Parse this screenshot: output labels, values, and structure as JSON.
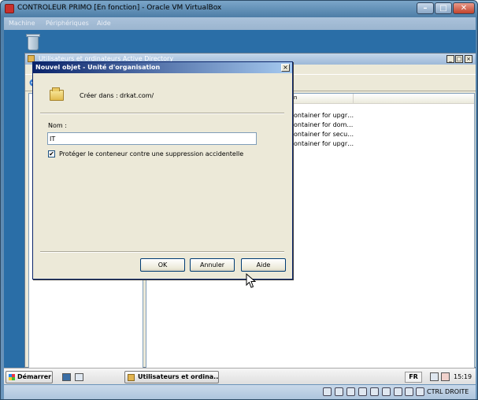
{
  "vbox": {
    "title": "CONTROLEUR PRIMO [En fonction] - Oracle VM VirtualBox",
    "menu": [
      "Machine",
      "Périphériques",
      "Aide"
    ],
    "host_key": "CTRL DROITE"
  },
  "ad_window": {
    "title": "Utilisateurs et ordinateurs Active Directory",
    "list_header_partial": "n",
    "rows": [
      "ontainer for upgr…",
      "ontainer for dom…",
      "ontainer for secu…",
      "ontainer for upgr…"
    ]
  },
  "dialog": {
    "title": "Nouvel objet - Unité d'organisation",
    "create_in_label": "Créer dans :",
    "create_in_value": "drkat.com/",
    "name_label": "Nom :",
    "name_value": "IT",
    "protect_checkbox_label": "Protéger le conteneur contre une suppression accidentelle",
    "protect_checked": true,
    "check_glyph": "✔",
    "buttons": {
      "ok": "OK",
      "cancel": "Annuler",
      "help": "Aide"
    }
  },
  "taskbar": {
    "start_label": "Démarrer",
    "task_label": "Utilisateurs et ordina...",
    "lang": "FR",
    "time": "15:19"
  }
}
